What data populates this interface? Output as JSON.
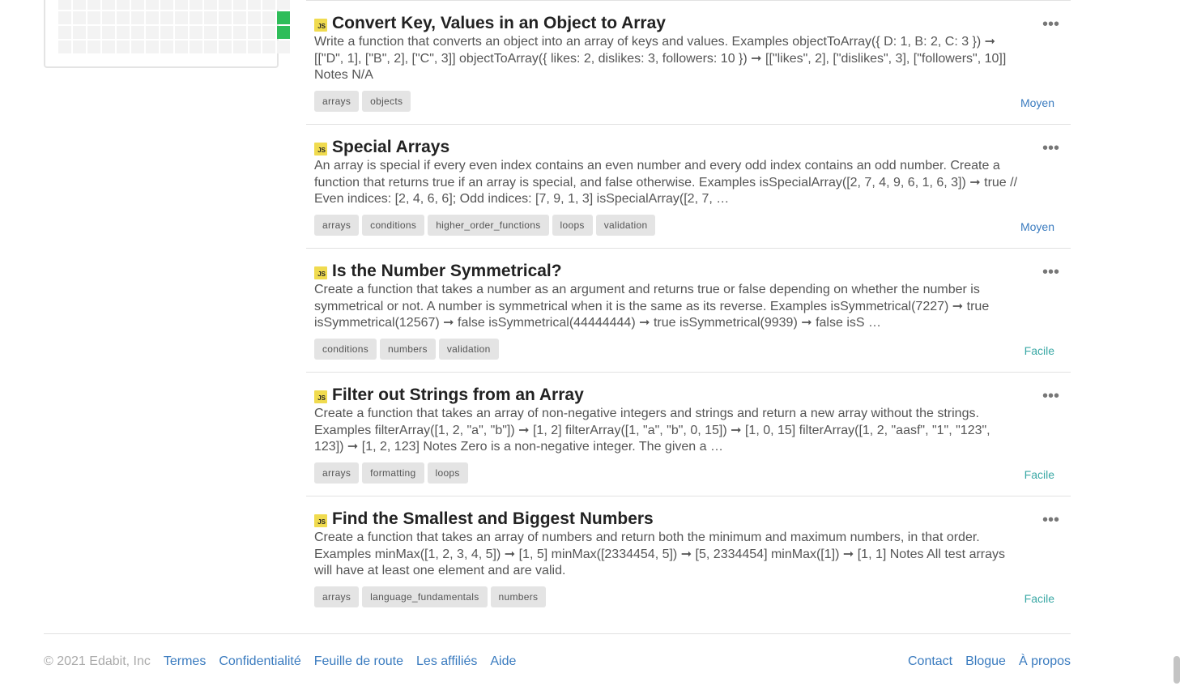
{
  "activity": {
    "rows": 4,
    "cols": 16,
    "active_cells": [
      [
        1,
        15
      ],
      [
        2,
        15
      ]
    ]
  },
  "challenges": [
    {
      "lang_badge": "JS",
      "title": "Convert Key, Values in an Object to Array",
      "desc": "Write a function that converts an object into an array of keys and values. Examples objectToArray({ D: 1, B: 2, C: 3 }) ➞ [[\"D\", 1], [\"B\", 2], [\"C\", 3]] objectToArray({ likes: 2, dislikes: 3, followers: 10 }) ➞ [[\"likes\", 2], [\"dislikes\", 3], [\"followers\", 10]] Notes N/A",
      "tags": [
        "arrays",
        "objects"
      ],
      "level": "Moyen",
      "level_kind": "medium"
    },
    {
      "lang_badge": "JS",
      "title": "Special Arrays",
      "desc": "An array is special if every even index contains an even number and every odd index contains an odd number. Create a function that returns true if an array is special, and false otherwise. Examples isSpecialArray([2, 7, 4, 9, 6, 1, 6, 3]) ➞ true // Even indices: [2, 4, 6, 6]; Odd indices: [7, 9, 1, 3] isSpecialArray([2, 7, …",
      "tags": [
        "arrays",
        "conditions",
        "higher_order_functions",
        "loops",
        "validation"
      ],
      "level": "Moyen",
      "level_kind": "medium"
    },
    {
      "lang_badge": "JS",
      "title": "Is the Number Symmetrical?",
      "desc": "Create a function that takes a number as an argument and returns true or false depending on whether the number is symmetrical or not. A number is symmetrical when it is the same as its reverse. Examples isSymmetrical(7227) ➞ true isSymmetrical(12567) ➞ false isSymmetrical(44444444) ➞ true isSymmetrical(9939) ➞ false isS …",
      "tags": [
        "conditions",
        "numbers",
        "validation"
      ],
      "level": "Facile",
      "level_kind": "easy"
    },
    {
      "lang_badge": "JS",
      "title": "Filter out Strings from an Array",
      "desc": "Create a function that takes an array of non-negative integers and strings and return a new array without the strings. Examples filterArray([1, 2, \"a\", \"b\"]) ➞ [1, 2] filterArray([1, \"a\", \"b\", 0, 15]) ➞ [1, 0, 15] filterArray([1, 2, \"aasf\", \"1\", \"123\", 123]) ➞ [1, 2, 123] Notes Zero is a non-negative integer. The given a …",
      "tags": [
        "arrays",
        "formatting",
        "loops"
      ],
      "level": "Facile",
      "level_kind": "easy"
    },
    {
      "lang_badge": "JS",
      "title": "Find the Smallest and Biggest Numbers",
      "desc": "Create a function that takes an array of numbers and return both the minimum and maximum numbers, in that order. Examples minMax([1, 2, 3, 4, 5]) ➞ [1, 5] minMax([2334454, 5]) ➞ [5, 2334454] minMax([1]) ➞ [1, 1] Notes All test arrays will have at least one element and are valid.",
      "tags": [
        "arrays",
        "language_fundamentals",
        "numbers"
      ],
      "level": "Facile",
      "level_kind": "easy"
    }
  ],
  "more_glyph": "•••",
  "footer": {
    "copyright": "© 2021 Edabit, Inc",
    "left_links": [
      "Termes",
      "Confidentialité",
      "Feuille de route",
      "Les affiliés",
      "Aide"
    ],
    "right_links": [
      "Contact",
      "Blogue",
      "À propos"
    ]
  },
  "colors": {
    "accent_link": "#3a7bbf",
    "easy": "#3aa8a5",
    "medium": "#3a7bbf",
    "activity_on": "#2ebd59",
    "js_badge": "#f0db4f"
  }
}
